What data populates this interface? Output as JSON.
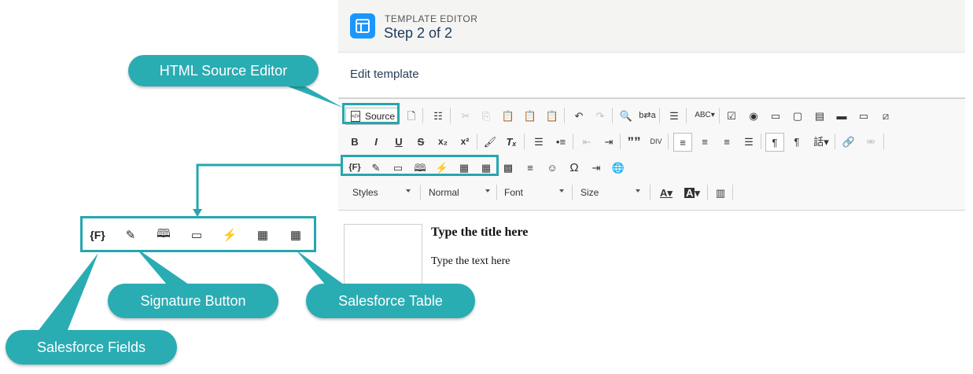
{
  "header": {
    "eyebrow": "TEMPLATE EDITOR",
    "step": "Step 2 of 2",
    "brand_color": "#1b96ff"
  },
  "edit_label": "Edit template",
  "toolbar": {
    "source_label": "Source",
    "styles_label": "Styles",
    "format_label": "Normal",
    "font_label": "Font",
    "size_label": "Size",
    "bold": "B",
    "italic": "I",
    "underline": "U",
    "strike": "S",
    "subscript": "x₂",
    "superscript": "x²",
    "fields_token": "{F}",
    "omega": "Ω",
    "quote": "””"
  },
  "content": {
    "title": "Type the title here",
    "text": "Type the text here"
  },
  "callouts": {
    "html_source_editor": "HTML Source Editor",
    "signature_button": "Signature Button",
    "salesforce_table": "Salesforce Table",
    "salesforce_fields": "Salesforce Fields",
    "fields_token": "{F}",
    "accent_color": "#2aacb3"
  }
}
